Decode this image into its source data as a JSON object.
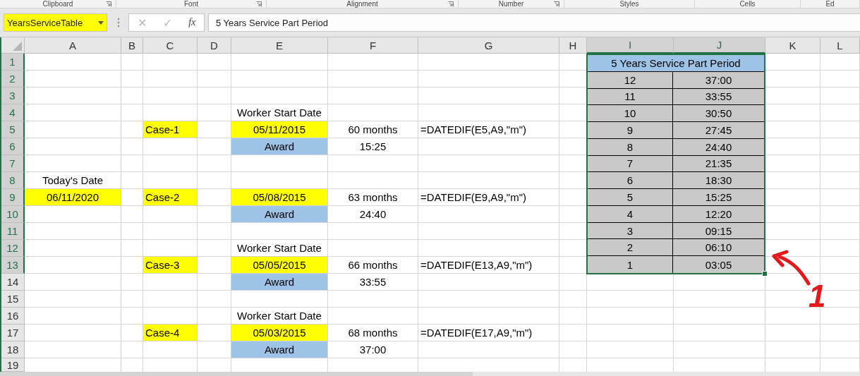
{
  "ribbon_groups": [
    {
      "label": "Clipboard",
      "launcher": true
    },
    {
      "label": "Font",
      "launcher": true
    },
    {
      "label": "Alignment",
      "launcher": true
    },
    {
      "label": "Number",
      "launcher": true
    },
    {
      "label": "Styles",
      "launcher": false
    },
    {
      "label": "Cells",
      "launcher": false
    },
    {
      "label": "Ed",
      "launcher": false
    }
  ],
  "formula_bar": {
    "name_box": {
      "value": "YearsServiceTable",
      "highlighted": true
    },
    "cancel": {
      "label": "✕",
      "disabled": true
    },
    "enter": {
      "label": "✓",
      "disabled": true
    },
    "function_label": "fx",
    "formula": "5 Years Service Part Period"
  },
  "columns": [
    {
      "label": "A",
      "selected": false
    },
    {
      "label": "B",
      "selected": false
    },
    {
      "label": "C",
      "selected": false
    },
    {
      "label": "D",
      "selected": false
    },
    {
      "label": "E",
      "selected": false
    },
    {
      "label": "F",
      "selected": false
    },
    {
      "label": "G",
      "selected": false
    },
    {
      "label": "H",
      "selected": false
    },
    {
      "label": "I",
      "selected": true
    },
    {
      "label": "J",
      "selected": true
    },
    {
      "label": "K",
      "selected": false
    },
    {
      "label": "L",
      "selected": false
    }
  ],
  "rows": [
    {
      "header": "1",
      "selected": true
    },
    {
      "header": "2",
      "selected": true
    },
    {
      "header": "3",
      "selected": true
    },
    {
      "header": "4",
      "selected": true,
      "cells": [
        {
          "kind": "blank"
        },
        {
          "kind": "blank"
        },
        {
          "kind": "blank"
        },
        {
          "kind": "blank"
        },
        {
          "kind": "heading",
          "text": "Worker Start Date"
        }
      ]
    },
    {
      "header": "5",
      "selected": true,
      "cells": [
        {
          "kind": "blank"
        },
        {
          "kind": "blank"
        },
        {
          "kind": "case",
          "text": "Case-1",
          "color": "#ffff00"
        },
        {
          "kind": "blank"
        },
        {
          "kind": "date",
          "text": "05/11/2015",
          "color": "#ffff00"
        },
        {
          "kind": "value",
          "text": "60 months"
        },
        {
          "kind": "formula",
          "text": "=DATEDIF(E5,A9,\"m\")"
        }
      ]
    },
    {
      "header": "6",
      "selected": true,
      "cells": [
        {
          "kind": "blank"
        },
        {
          "kind": "blank"
        },
        {
          "kind": "blank"
        },
        {
          "kind": "blank"
        },
        {
          "kind": "award",
          "text": "Award",
          "color": "#9dc3e6"
        },
        {
          "kind": "value",
          "text": "15:25"
        }
      ]
    },
    {
      "header": "7",
      "selected": true
    },
    {
      "header": "8",
      "selected": true,
      "cells": [
        {
          "kind": "heading",
          "text": "Today's Date"
        }
      ]
    },
    {
      "header": "9",
      "selected": true,
      "cells": [
        {
          "kind": "date",
          "text": "06/11/2020",
          "color": "#ffff00"
        },
        {
          "kind": "blank"
        },
        {
          "kind": "case",
          "text": "Case-2",
          "color": "#ffff00"
        },
        {
          "kind": "blank"
        },
        {
          "kind": "date",
          "text": "05/08/2015",
          "color": "#ffff00"
        },
        {
          "kind": "value",
          "text": "63 months"
        },
        {
          "kind": "formula",
          "text": "=DATEDIF(E9,A9,\"m\")"
        }
      ]
    },
    {
      "header": "10",
      "selected": true,
      "cells": [
        {
          "kind": "blank"
        },
        {
          "kind": "blank"
        },
        {
          "kind": "blank"
        },
        {
          "kind": "blank"
        },
        {
          "kind": "award",
          "text": "Award",
          "color": "#9dc3e6"
        },
        {
          "kind": "value",
          "text": "24:40"
        }
      ]
    },
    {
      "header": "11",
      "selected": true
    },
    {
      "header": "12",
      "selected": true,
      "cells": [
        {
          "kind": "blank"
        },
        {
          "kind": "blank"
        },
        {
          "kind": "blank"
        },
        {
          "kind": "blank"
        },
        {
          "kind": "heading",
          "text": "Worker Start Date"
        }
      ]
    },
    {
      "header": "13",
      "selected": true,
      "cells": [
        {
          "kind": "blank"
        },
        {
          "kind": "blank"
        },
        {
          "kind": "case",
          "text": "Case-3",
          "color": "#ffff00"
        },
        {
          "kind": "blank"
        },
        {
          "kind": "date",
          "text": "05/05/2015",
          "color": "#ffff00"
        },
        {
          "kind": "value",
          "text": "66 months"
        },
        {
          "kind": "formula",
          "text": "=DATEDIF(E13,A9,\"m\")"
        }
      ]
    },
    {
      "header": "14",
      "selected": false,
      "cells": [
        {
          "kind": "blank"
        },
        {
          "kind": "blank"
        },
        {
          "kind": "blank"
        },
        {
          "kind": "blank"
        },
        {
          "kind": "award",
          "text": "Award",
          "color": "#9dc3e6"
        },
        {
          "kind": "value",
          "text": "33:55"
        }
      ]
    },
    {
      "header": "15",
      "selected": false
    },
    {
      "header": "16",
      "selected": false,
      "cells": [
        {
          "kind": "blank"
        },
        {
          "kind": "blank"
        },
        {
          "kind": "blank"
        },
        {
          "kind": "blank"
        },
        {
          "kind": "heading",
          "text": "Worker Start Date"
        }
      ]
    },
    {
      "header": "17",
      "selected": false,
      "cells": [
        {
          "kind": "blank"
        },
        {
          "kind": "blank"
        },
        {
          "kind": "case",
          "text": "Case-4",
          "color": "#ffff00"
        },
        {
          "kind": "blank"
        },
        {
          "kind": "date",
          "text": "05/03/2015",
          "color": "#ffff00"
        },
        {
          "kind": "value",
          "text": "68 months"
        },
        {
          "kind": "formula",
          "text": "=DATEDIF(E17,A9,\"m\")"
        }
      ]
    },
    {
      "header": "18",
      "selected": false,
      "cells": [
        {
          "kind": "blank"
        },
        {
          "kind": "blank"
        },
        {
          "kind": "blank"
        },
        {
          "kind": "blank"
        },
        {
          "kind": "award",
          "text": "Award",
          "color": "#9dc3e6"
        },
        {
          "kind": "value",
          "text": "37:00"
        }
      ]
    },
    {
      "header": "19",
      "selected": false
    }
  ],
  "service_table": {
    "title": "5 Years Service Part Period",
    "rows": [
      {
        "years": "12",
        "time": "37:00"
      },
      {
        "years": "11",
        "time": "33:55"
      },
      {
        "years": "10",
        "time": "30:50"
      },
      {
        "years": "9",
        "time": "27:45"
      },
      {
        "years": "8",
        "time": "24:40"
      },
      {
        "years": "7",
        "time": "21:35"
      },
      {
        "years": "6",
        "time": "18:30"
      },
      {
        "years": "5",
        "time": "15:25"
      },
      {
        "years": "4",
        "time": "12:20"
      },
      {
        "years": "3",
        "time": "09:15"
      },
      {
        "years": "2",
        "time": "06:10"
      },
      {
        "years": "1",
        "time": "03:05"
      }
    ]
  },
  "annotation": {
    "label": "1"
  }
}
